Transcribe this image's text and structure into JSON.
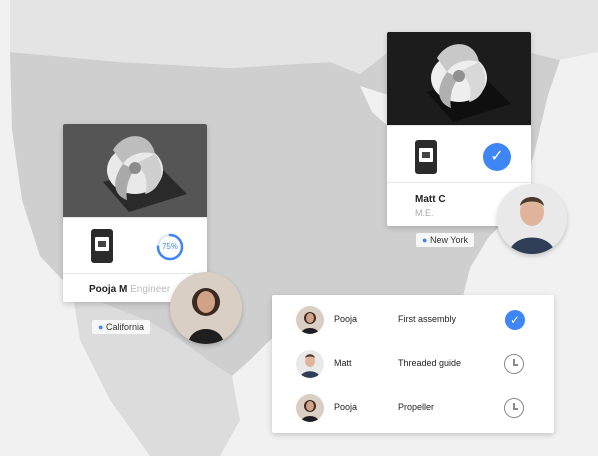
{
  "cards": {
    "left": {
      "name": "Pooja M",
      "role": "Engineer",
      "progress_label": "75%",
      "progress_value": 0.75,
      "location": "California",
      "accent_color": "#3e86f5"
    },
    "right": {
      "name": "Matt C",
      "role": "M.E.",
      "status": "complete",
      "location": "New York",
      "accent_color": "#3e86f5"
    }
  },
  "task_list": [
    {
      "person": "Pooja",
      "task": "First assembly",
      "status": "complete",
      "status_icon": "check-circle-icon"
    },
    {
      "person": "Matt",
      "task": "Threaded guide",
      "status": "pending",
      "status_icon": "clock-icon"
    },
    {
      "person": "Pooja",
      "task": "Propeller",
      "status": "pending",
      "status_icon": "clock-icon"
    }
  ],
  "icons": {
    "location": "location-pin-icon",
    "file": "phone-file-icon",
    "check": "check-icon"
  }
}
